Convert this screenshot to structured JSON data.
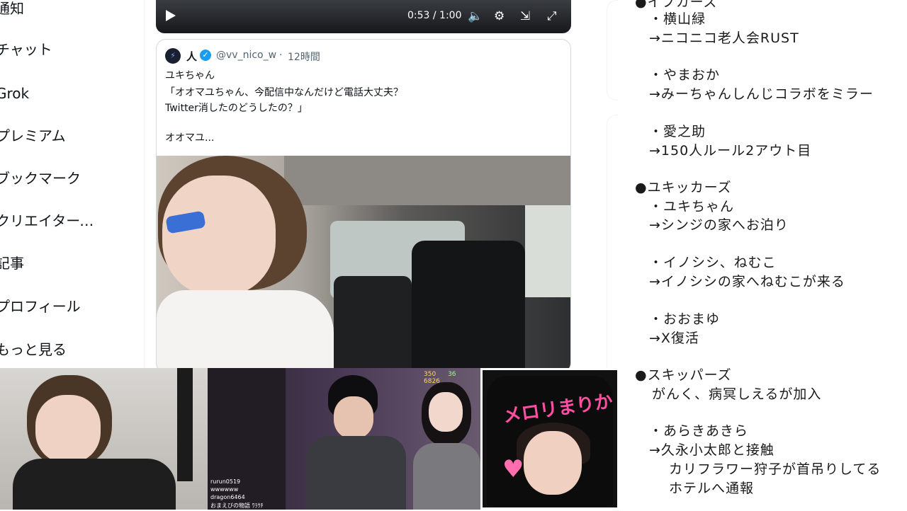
{
  "nav": {
    "items": [
      "通知",
      "チャット",
      "Grok",
      "プレミアム",
      "ブックマーク",
      "クリエイタースタジオ...",
      "記事",
      "プロフィール",
      "もっと見る"
    ]
  },
  "video": {
    "time": "0:53 / 1:00",
    "icons": [
      "play-icon",
      "volume-icon",
      "settings-icon",
      "pip-icon",
      "fullscreen-icon"
    ]
  },
  "quote": {
    "author": "人",
    "handle": "@vv_nico_w",
    "separator": "·",
    "time": "12時間",
    "lines": [
      "ユキちゃん",
      "「オオマユちゃん、今配信中なんだけど電話大丈夫？",
      "Twitter消したのどうしたの？」",
      "",
      "オオマユ..."
    ]
  },
  "notes": {
    "lines": [
      "●イブカーズ",
      "・横山緑",
      "→ニコニコ老人会RUST",
      "・やまおか",
      "→みーちゃんしんじコラボをミラー",
      "・愛之助",
      "→150人ルール2アウト目",
      "●ユキッカーズ",
      "・ユキちゃん",
      "→シンジの家へお泊り",
      "・イノシシ、ねむこ",
      "→イノシシの家へねむこが来る",
      "・おおまゆ",
      "→X復活",
      "●スキッパーズ",
      "がんく、病冥しえるが加入",
      "・あらきあきら",
      "→久永小太郎と接触",
      "カリフラワー狩子が首吊りしてる",
      "ホテルへ通報"
    ]
  },
  "thumb2": {
    "stats": [
      "350",
      "36",
      "6826"
    ],
    "chat": [
      "rurun0519",
      "wwwwww",
      "dragon6464",
      "おまえびの物語 ﾜﾗｳﾁ"
    ]
  },
  "thumb3": {
    "title": "メロリまりか",
    "heart": "好き"
  }
}
